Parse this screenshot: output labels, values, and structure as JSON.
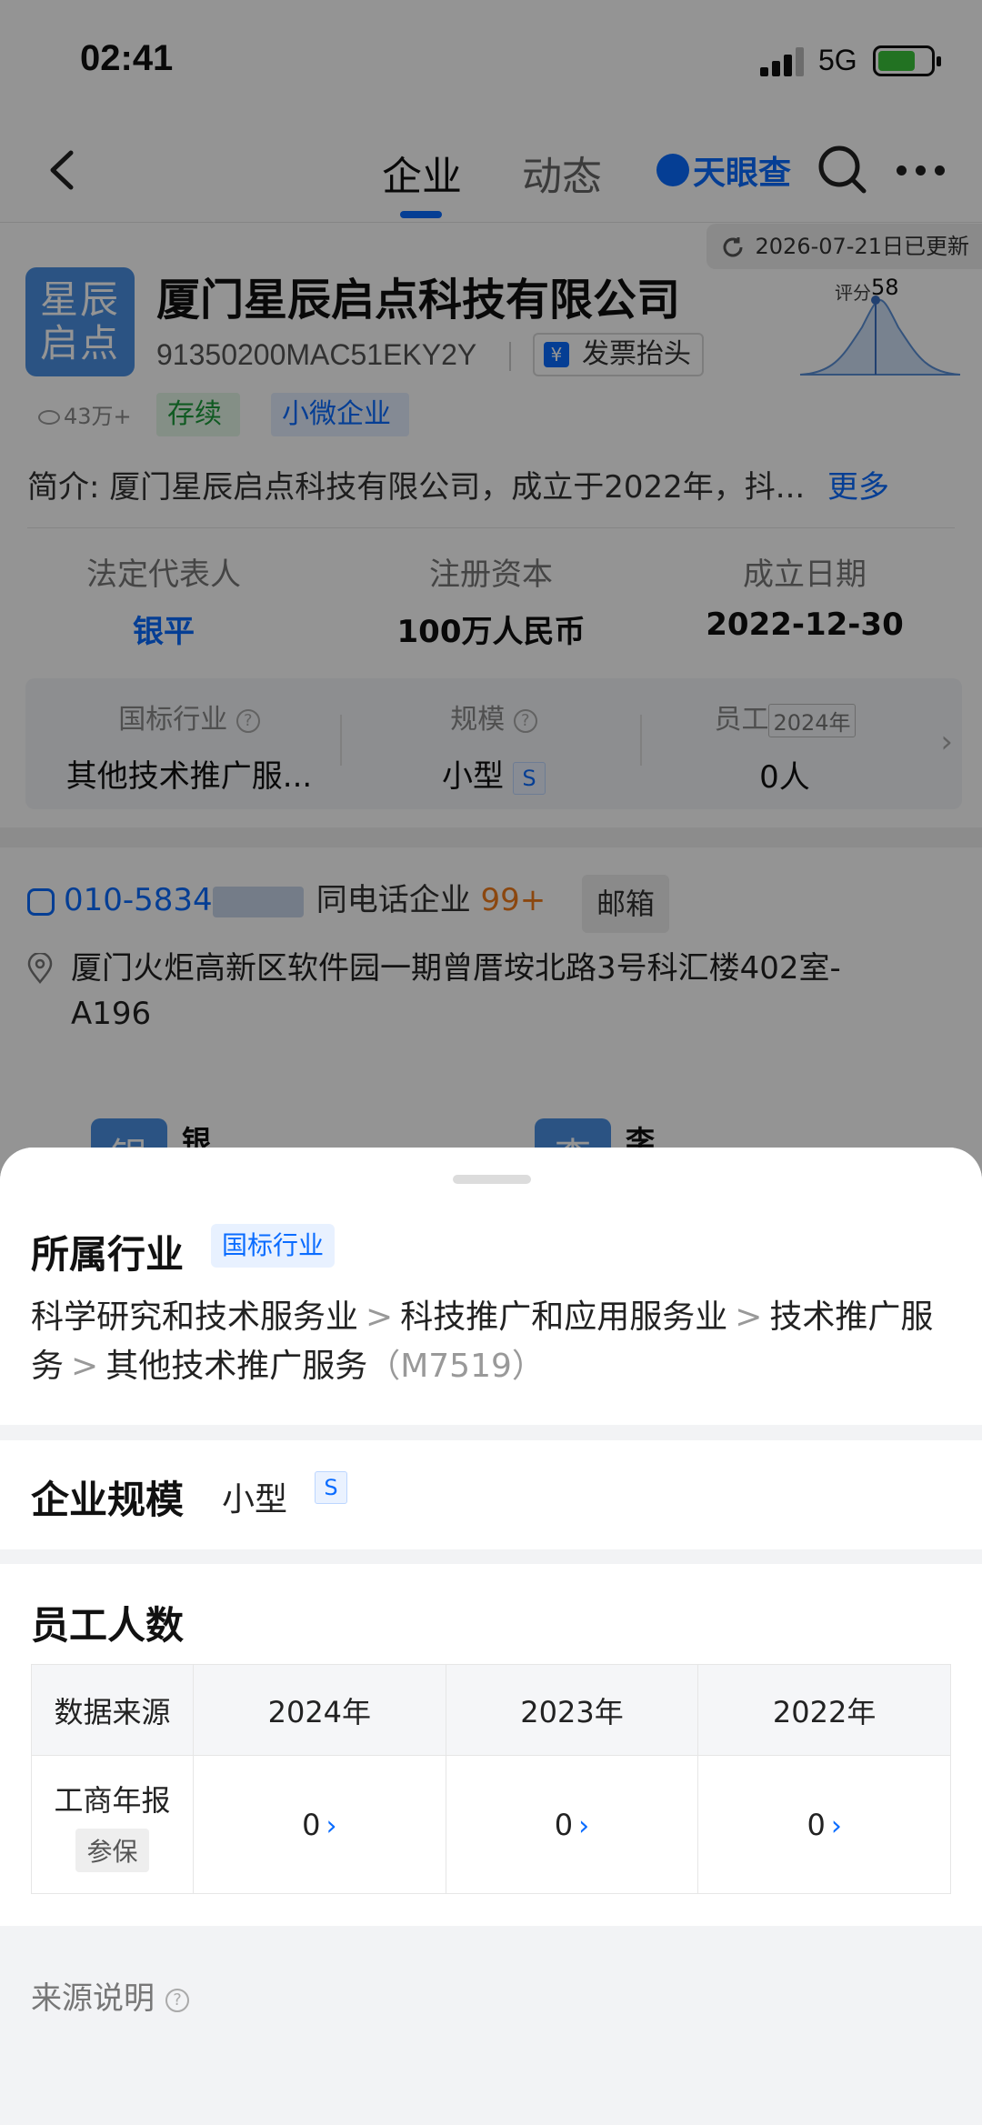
{
  "status_bar": {
    "time": "02:41",
    "network": "5G"
  },
  "nav": {
    "tabs": [
      "企业",
      "动态"
    ],
    "brand": "天眼查"
  },
  "company": {
    "updated": "2026-07-21日已更新",
    "logo_text": "星辰\n启点",
    "logo_line1": "星辰",
    "logo_line2": "启点",
    "name": "厦门星辰启点科技有限公司",
    "credit_code": "91350200MAC51EKY2Y",
    "invoice_label": "发票抬头",
    "invoice_icon": "yuan-icon",
    "score_label": "评分",
    "score_value": "58",
    "views": "43万+",
    "status_tag": "存续",
    "size_tag": "小微企业",
    "intro_label": "简介:",
    "intro_text": "厦门星辰启点科技有限公司，成立于2022年，抖...",
    "more_label": "更多"
  },
  "key_info": [
    {
      "label": "法定代表人",
      "value": "银平"
    },
    {
      "label": "注册资本",
      "value": "100万人民币"
    },
    {
      "label": "成立日期",
      "value": "2022-12-30"
    }
  ],
  "industry_strip": {
    "industry_label": "国标行业",
    "industry_value": "其他技术推广服...",
    "scale_label": "规模",
    "scale_value": "小型",
    "scale_badge": "S",
    "staff_label": "员工",
    "staff_year": "2024年",
    "staff_value": "0人"
  },
  "contact": {
    "phone": "010-5834",
    "same_phone_label": "同电话企业",
    "same_phone_count": "99+",
    "email_label": "邮箱",
    "address": "厦门火炬高新区软件园一期曾厝垵北路3号科汇楼402室-A196"
  },
  "people": [
    {
      "avatar": "银",
      "name": "银平"
    },
    {
      "avatar": "李",
      "name": "李英"
    }
  ],
  "sheet": {
    "industry": {
      "title": "所属行业",
      "tag": "国标行业",
      "path": [
        "科学研究和技术服务业",
        "科技推广和应用服务业",
        "技术推广服务",
        "其他技术推广服务"
      ],
      "separator": ">",
      "code": "（M7519）"
    },
    "scale": {
      "title": "企业规模",
      "value": "小型",
      "badge": "S"
    },
    "employees": {
      "title": "员工人数",
      "header": [
        "数据来源",
        "2024年",
        "2023年",
        "2022年"
      ],
      "row_source": "工商年报",
      "row_tag": "参保",
      "values": [
        "0",
        "0",
        "0"
      ],
      "chevron": "›"
    },
    "source_note": "来源说明"
  },
  "colors": {
    "accent": "#0a6cff",
    "status_green": "#1c9b3c",
    "count_orange": "#f07a1a"
  }
}
